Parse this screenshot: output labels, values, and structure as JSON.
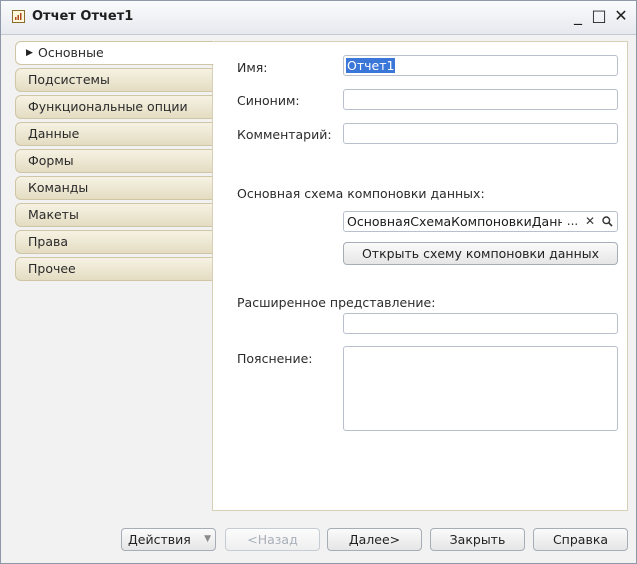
{
  "window": {
    "title": "Отчет Отчет1",
    "minimize_glyph": "_",
    "maximize_glyph": "□",
    "close_glyph": "✕"
  },
  "tabs": [
    {
      "label": "Основные",
      "active": true
    },
    {
      "label": "Подсистемы",
      "active": false
    },
    {
      "label": "Функциональные опции",
      "active": false
    },
    {
      "label": "Данные",
      "active": false
    },
    {
      "label": "Формы",
      "active": false
    },
    {
      "label": "Команды",
      "active": false
    },
    {
      "label": "Макеты",
      "active": false
    },
    {
      "label": "Права",
      "active": false
    },
    {
      "label": "Прочее",
      "active": false
    }
  ],
  "form": {
    "name_label": "Имя:",
    "name_value": "Отчет1",
    "synonym_label": "Синоним:",
    "synonym_value": "",
    "comment_label": "Комментарий:",
    "comment_value": "",
    "schema_label": "Основная схема компоновки данных:",
    "schema_value": "ОсновнаяСхемаКомпоновкиДанных",
    "schema_select_glyph": "...",
    "schema_clear_glyph": "✕",
    "schema_open_icon": "search-icon",
    "open_schema_button": "Открыть схему компоновки данных",
    "extended_repr_label": "Расширенное представление:",
    "extended_repr_value": "",
    "explanation_label": "Пояснение:",
    "explanation_value": ""
  },
  "footer": {
    "actions_label": "Действия",
    "back_label": "<Назад",
    "next_label": "Далее>",
    "close_label": "Закрыть",
    "help_label": "Справка"
  },
  "colors": {
    "selection": "#3a77d8",
    "tab_bg": "#e9e3cb",
    "disabled_text": "#a8b0bb"
  }
}
